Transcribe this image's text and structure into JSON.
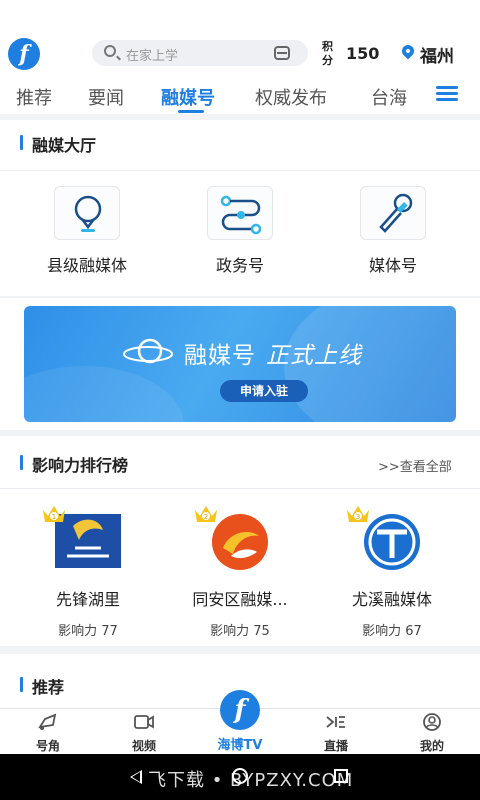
{
  "header": {
    "search_placeholder": "在家上学",
    "points_label": "积分",
    "points_value": "150",
    "city": "福州"
  },
  "tabs": [
    {
      "label": "推荐"
    },
    {
      "label": "要闻"
    },
    {
      "label": "融媒号"
    },
    {
      "label": "权威发布"
    },
    {
      "label": "台海"
    }
  ],
  "hall": {
    "title": "融媒大厅",
    "items": [
      {
        "label": "县级融媒体",
        "icon": "location-bubble-icon"
      },
      {
        "label": "政务号",
        "icon": "flow-route-icon"
      },
      {
        "label": "媒体号",
        "icon": "microphone-icon"
      }
    ]
  },
  "banner": {
    "brand": "融媒号",
    "slogan": "正式上线",
    "button": "申请入驻"
  },
  "ranking": {
    "title": "影响力排行榜",
    "view_all": ">>查看全部",
    "items": [
      {
        "name": "先锋湖里",
        "score": "影响力 77",
        "rank": "1"
      },
      {
        "name": "同安区融媒...",
        "score": "影响力 75",
        "rank": "2"
      },
      {
        "name": "尤溪融媒体",
        "score": "影响力 67",
        "rank": "3"
      }
    ]
  },
  "recommend": {
    "title": "推荐"
  },
  "bottom_nav": {
    "items": [
      {
        "label": "号角",
        "icon": "horn-icon"
      },
      {
        "label": "视频",
        "icon": "video-icon"
      },
      {
        "label": "海博TV",
        "icon": "haibo-logo"
      },
      {
        "label": "直播",
        "icon": "live-icon"
      },
      {
        "label": "我的",
        "icon": "profile-icon"
      }
    ]
  },
  "watermark": "飞下载 • BYPZXY.COM",
  "colors": {
    "accent": "#1f7fe0",
    "banner": "#3a9cec",
    "crown": "#f5c518"
  }
}
